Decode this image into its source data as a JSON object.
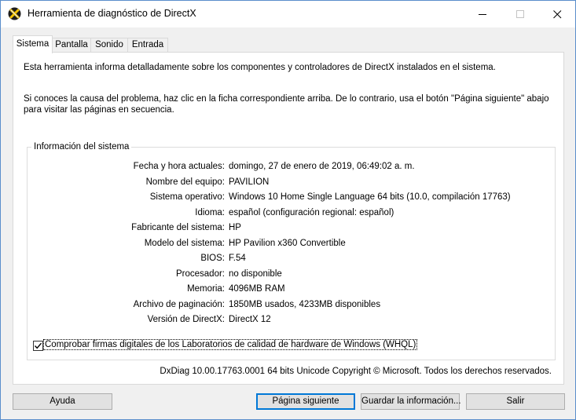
{
  "window": {
    "title": "Herramienta de diagnóstico de DirectX"
  },
  "tabs": [
    {
      "label": "Sistema",
      "active": true
    },
    {
      "label": "Pantalla",
      "active": false
    },
    {
      "label": "Sonido",
      "active": false
    },
    {
      "label": "Entrada",
      "active": false
    }
  ],
  "intro": {
    "line1": "Esta herramienta informa detalladamente sobre los componentes y controladores de DirectX instalados en el sistema.",
    "line2": "Si conoces la causa del problema, haz clic en la ficha correspondiente arriba. De lo contrario, usa el botón \"Página siguiente\" abajo para visitar las páginas en secuencia."
  },
  "system_info": {
    "legend": "Información del sistema",
    "rows": [
      {
        "label": "Fecha y hora actuales:",
        "value": "domingo, 27 de enero de 2019, 06:49:02 a. m."
      },
      {
        "label": "Nombre del equipo:",
        "value": "PAVILION"
      },
      {
        "label": "Sistema operativo:",
        "value": "Windows 10 Home Single Language 64 bits (10.0, compilación 17763)"
      },
      {
        "label": "Idioma:",
        "value": "español (configuración regional: español)"
      },
      {
        "label": "Fabricante del sistema:",
        "value": "HP"
      },
      {
        "label": "Modelo del sistema:",
        "value": "HP Pavilion x360 Convertible"
      },
      {
        "label": "BIOS:",
        "value": "F.54"
      },
      {
        "label": "Procesador:",
        "value": "no disponible"
      },
      {
        "label": "Memoria:",
        "value": "4096MB RAM"
      },
      {
        "label": "Archivo de paginación:",
        "value": "1850MB usados, 4233MB disponibles"
      },
      {
        "label": "Versión de DirectX:",
        "value": "DirectX 12"
      }
    ]
  },
  "whql_checkbox": {
    "label": "Comprobar firmas digitales de los Laboratorios de calidad de hardware de Windows (WHQL)",
    "checked": true
  },
  "copyright": "DxDiag 10.00.17763.0001 64 bits Unicode  Copyright © Microsoft. Todos los derechos reservados.",
  "buttons": {
    "help": "Ayuda",
    "next": "Página siguiente",
    "save": "Guardar la información...",
    "exit": "Salir"
  },
  "colors": {
    "accent": "#0078d7",
    "window_border": "#5a8ecb",
    "background": "#f0f0f0"
  }
}
